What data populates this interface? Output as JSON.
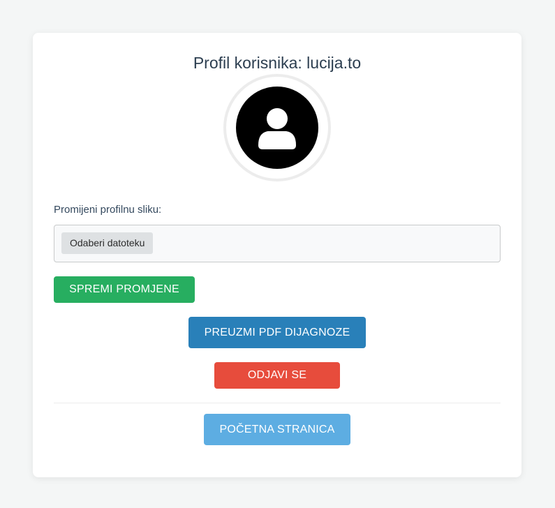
{
  "profile": {
    "title": "Profil korisnika: lucija.to",
    "avatar_icon": "user-circle-icon"
  },
  "upload": {
    "label": "Promijeni profilnu sliku:",
    "file_button_label": "Odaberi datoteku"
  },
  "actions": {
    "save_label": "SPREMI PROMJENE",
    "pdf_label": "PREUZMI PDF DIJAGNOZE",
    "logout_label": "ODJAVI SE",
    "home_label": "POČETNA STRANICA"
  },
  "colors": {
    "save": "#27ae60",
    "pdf": "#2980b9",
    "logout": "#e74c3c",
    "home": "#5dade2",
    "title": "#2c3e50"
  }
}
